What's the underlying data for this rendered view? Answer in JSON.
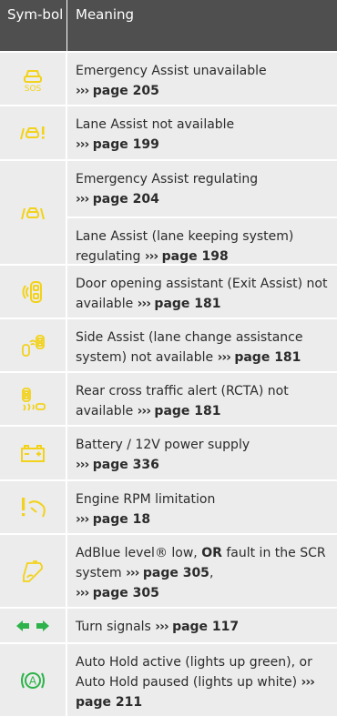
{
  "header": {
    "symbol": "Sym-bol",
    "meaning": "Meaning"
  },
  "colors": {
    "yellow": "#f2d21a",
    "green": "#2db34a",
    "header_bg": "#4f4f4f",
    "row_bg": "#ececec"
  },
  "rows": [
    {
      "icon": "car-sos-icon",
      "color": "#f2d21a",
      "entries": [
        {
          "text": "Emergency Assist unavailable",
          "arrows": "›››",
          "ref": "page 205"
        }
      ]
    },
    {
      "icon": "lane-assist-warning-icon",
      "color": "#f2d21a",
      "entries": [
        {
          "text": "Lane Assist not available",
          "arrows": "›››",
          "ref": "page 199"
        }
      ]
    },
    {
      "icon": "car-lane-regulating-icon",
      "color": "#f2d21a",
      "entries": [
        {
          "text": "Emergency Assist regulating",
          "arrows": "›››",
          "ref": "page 204"
        },
        {
          "text": "Lane Assist (lane keeping system) regulating",
          "arrows": "›››",
          "ref": "page 198"
        }
      ]
    },
    {
      "icon": "exit-assist-icon",
      "color": "#f2d21a",
      "entries": [
        {
          "text": "Door opening assistant (Exit Assist) not available",
          "arrows": "›››",
          "ref": "page 181"
        }
      ]
    },
    {
      "icon": "side-assist-icon",
      "color": "#f2d21a",
      "entries": [
        {
          "text": "Side Assist (lane change assistance system) not available",
          "arrows": "›››",
          "ref": "page 181"
        }
      ]
    },
    {
      "icon": "rear-cross-traffic-icon",
      "color": "#f2d21a",
      "entries": [
        {
          "text": "Rear cross traffic alert (RCTA) not available",
          "arrows": "›››",
          "ref": "page 181"
        }
      ]
    },
    {
      "icon": "battery-icon",
      "color": "#f2d21a",
      "entries": [
        {
          "text": "Battery / 12V power supply",
          "arrows": "›››",
          "ref": "page 336"
        }
      ]
    },
    {
      "icon": "engine-rpm-limit-icon",
      "color": "#f2d21a",
      "entries": [
        {
          "text": "Engine RPM limitation",
          "arrows": "›››",
          "ref": "page 18"
        }
      ]
    },
    {
      "icon": "adblue-icon",
      "color": "#f2d21a",
      "entries": [
        {
          "text_a": "AdBlue level® low, ",
          "or": "OR",
          "text_b": " fault in the SCR system ",
          "arrows": "›››",
          "ref": "page 305",
          "suffix": ",",
          "arrows2": "›››",
          "ref2": "page 305"
        }
      ]
    },
    {
      "icon": "turn-signals-icon",
      "color": "#2db34a",
      "entries": [
        {
          "text": "Turn signals",
          "arrows": "›››",
          "ref": "page 117"
        }
      ]
    },
    {
      "icon": "auto-hold-icon",
      "color": "#2db34a",
      "entries": [
        {
          "text": "Auto Hold active (lights up green), or Auto Hold paused (lights up white)",
          "arrows": "›››",
          "ref": "page 211"
        }
      ]
    }
  ]
}
